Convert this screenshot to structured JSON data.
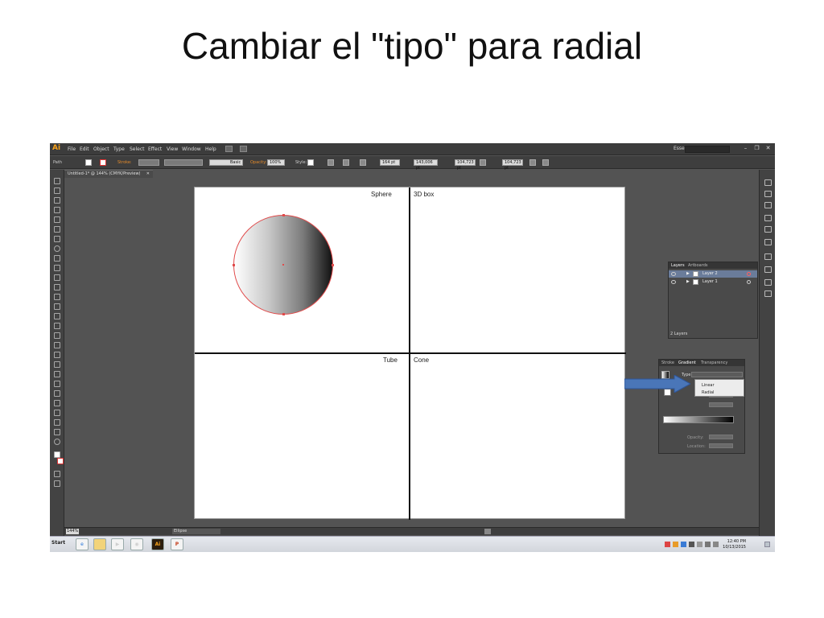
{
  "slide": {
    "title": "Cambiar el \"tipo\" para radial"
  },
  "app": {
    "logo": "Ai",
    "menu": [
      "File",
      "Edit",
      "Object",
      "Type",
      "Select",
      "Effect",
      "View",
      "Window",
      "Help"
    ],
    "workspace": "Essentials",
    "control": {
      "selection": "Path",
      "stroke_label": "Stroke:",
      "brush": "Basic",
      "opacity_label": "Opacity:",
      "opacity_value": "100%",
      "style_label": "Style:",
      "x_value": "164 pt",
      "y_value": "143,006 pt",
      "w_value": "104,723 pt",
      "h_value": "104,723 pt"
    },
    "document_tab": {
      "title": "Untitled-1* @ 144% (CMYK/Preview)",
      "close": "✕"
    },
    "artboard": {
      "cells": [
        "Sphere",
        "3D box",
        "Tube",
        "Cone"
      ]
    },
    "layers_panel": {
      "tabs": [
        "Layers",
        "Artboards"
      ],
      "layers": [
        "Layer 2",
        "Layer 1"
      ],
      "footer": "2 Layers"
    },
    "gradient_panel": {
      "tabs": [
        "Stroke",
        "Gradient",
        "Transparency"
      ],
      "type_label": "Type:",
      "options": [
        "Linear",
        "Radial"
      ],
      "opacity_label": "Opacity:",
      "location_label": "Location:"
    },
    "status": {
      "zoom": "144%",
      "tool": "Ellipse"
    },
    "taskbar": {
      "start": "Start",
      "time": "12:40 PM",
      "date": "10/13/2015"
    },
    "colors": {
      "annotation_arrow": "#4a76b8",
      "accent": "#f7a21b"
    }
  }
}
